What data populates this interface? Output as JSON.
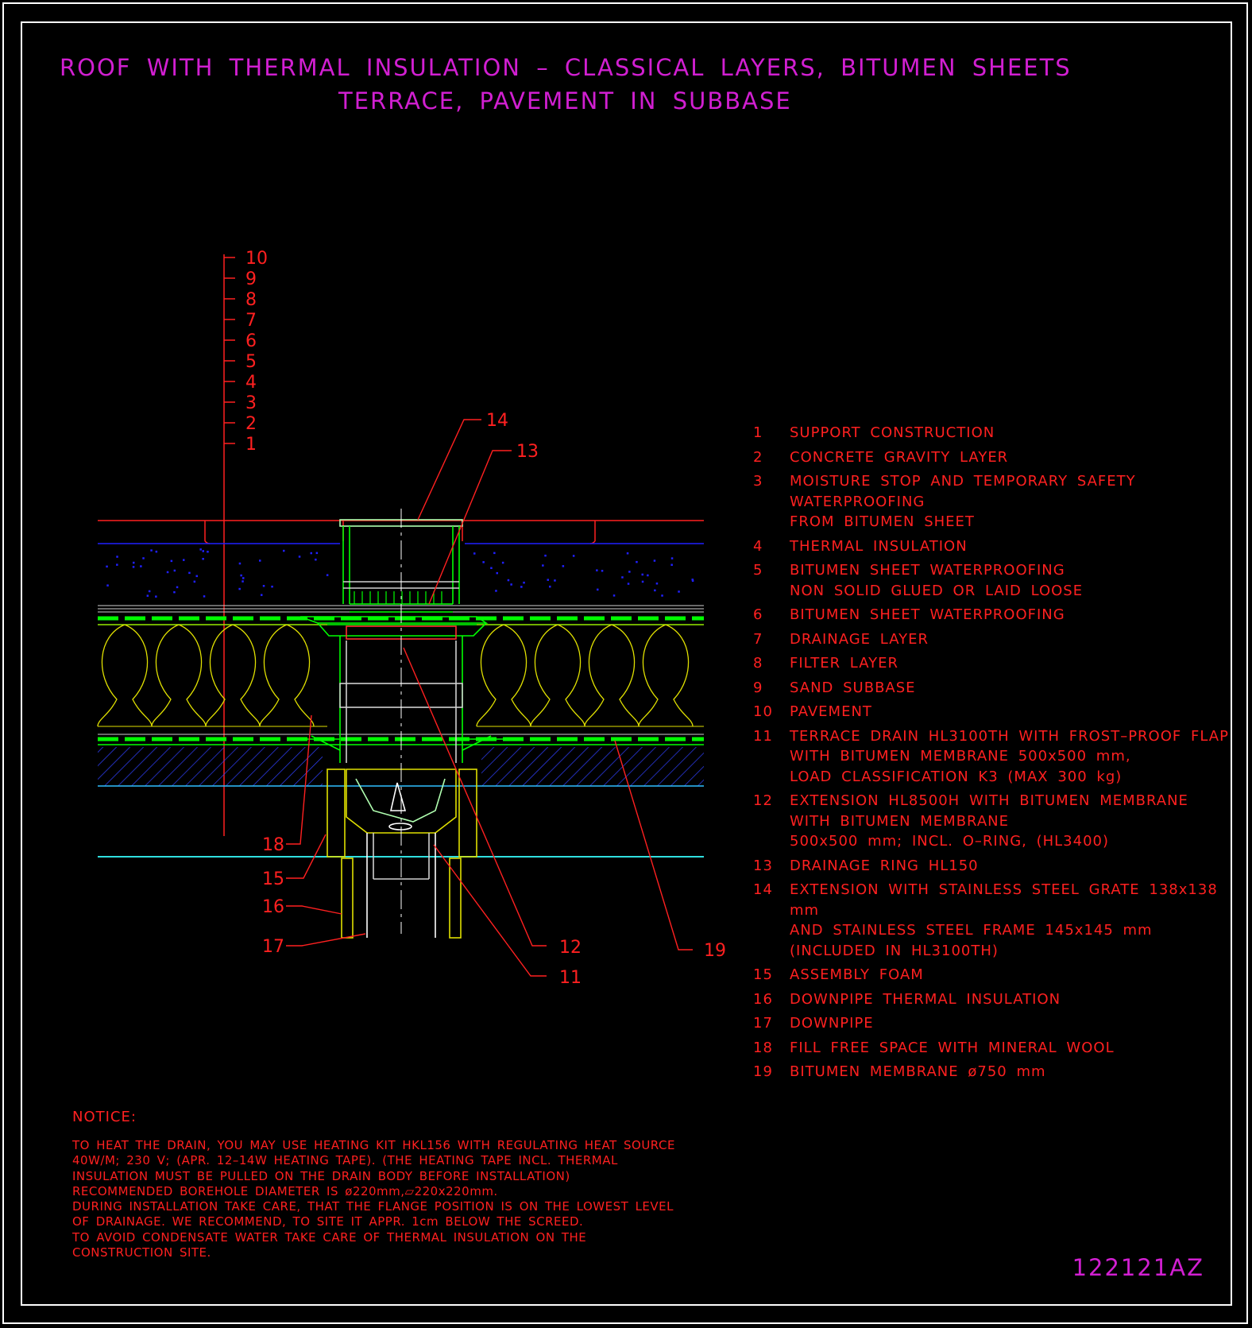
{
  "title": {
    "line1": "ROOF WITH THERMAL INSULATION – CLASSICAL LAYERS, BITUMEN SHEETS",
    "line2": "TERRACE, PAVEMENT IN SUBBASE"
  },
  "layer_scale": [
    "10",
    "9",
    "8",
    "7",
    "6",
    "5",
    "4",
    "3",
    "2",
    "1"
  ],
  "callouts": {
    "c11": "11",
    "c12": "12",
    "c13": "13",
    "c14": "14",
    "c15": "15",
    "c16": "16",
    "c17": "17",
    "c18": "18",
    "c19": "19"
  },
  "legend": [
    {
      "num": "1",
      "text": "SUPPORT CONSTRUCTION"
    },
    {
      "num": "2",
      "text": "CONCRETE GRAVITY LAYER"
    },
    {
      "num": "3",
      "text": "MOISTURE STOP AND TEMPORARY SAFETY WATERPROOFING\nFROM BITUMEN SHEET"
    },
    {
      "num": "4",
      "text": "THERMAL INSULATION"
    },
    {
      "num": "5",
      "text": "BITUMEN SHEET WATERPROOFING\nNON SOLID GLUED OR LAID LOOSE"
    },
    {
      "num": "6",
      "text": "BITUMEN SHEET WATERPROOFING"
    },
    {
      "num": "7",
      "text": "DRAINAGE LAYER"
    },
    {
      "num": "8",
      "text": "FILTER LAYER"
    },
    {
      "num": "9",
      "text": "SAND SUBBASE"
    },
    {
      "num": "10",
      "text": "PAVEMENT"
    },
    {
      "num": "11",
      "text": "TERRACE DRAIN HL3100TH WITH FROST–PROOF FLAP\nWITH BITUMEN MEMBRANE 500x500 mm,\nLOAD CLASSIFICATION K3 (MAX 300 kg)"
    },
    {
      "num": "12",
      "text": "EXTENSION HL8500H WITH BITUMEN MEMBRANE\nWITH BITUMEN MEMBRANE\n500x500 mm; INCL. O–RING, (HL3400)"
    },
    {
      "num": "13",
      "text": "DRAINAGE RING HL150"
    },
    {
      "num": "14",
      "text": "EXTENSION WITH STAINLESS STEEL GRATE 138x138 mm\nAND STAINLESS STEEL FRAME 145x145 mm\n(INCLUDED IN HL3100TH)"
    },
    {
      "num": "15",
      "text": "ASSEMBLY FOAM"
    },
    {
      "num": "16",
      "text": "DOWNPIPE THERMAL INSULATION"
    },
    {
      "num": "17",
      "text": "DOWNPIPE"
    },
    {
      "num": "18",
      "text": "FILL FREE SPACE WITH MINERAL WOOL"
    },
    {
      "num": "19",
      "text": "BITUMEN MEMBRANE ø750 mm"
    }
  ],
  "notice": {
    "title": "NOTICE:",
    "body": "TO HEAT THE DRAIN, YOU MAY USE HEATING KIT HKL156 WITH REGULATING HEAT SOURCE\n40W/M; 230 V;  (APR. 12–14W HEATING TAPE). (THE HEATING TAPE INCL. THERMAL\nINSULATION MUST BE PULLED ON THE DRAIN BODY BEFORE INSTALLATION)\nRECOMMENDED BOREHOLE DIAMETER IS ø220mm,▱220x220mm.\nDURING INSTALLATION TAKE CARE, THAT THE FLANGE POSITION IS ON THE LOWEST LEVEL\nOF DRAINAGE. WE RECOMMEND, TO SITE IT APPR. 1cm BELOW THE SCREED.\nTO AVOID CONDENSATE WATER TAKE CARE OF THERMAL INSULATION ON THE\nCONSTRUCTION SITE."
  },
  "drawing_id": "122121AZ",
  "colors": {
    "background": "#000000",
    "title": "#d11fd1",
    "annotation": "#ff2020",
    "structure": "#00ff00",
    "insulation": "#e0e000",
    "gravel": "#2020ff",
    "frame": "#ffffff"
  }
}
